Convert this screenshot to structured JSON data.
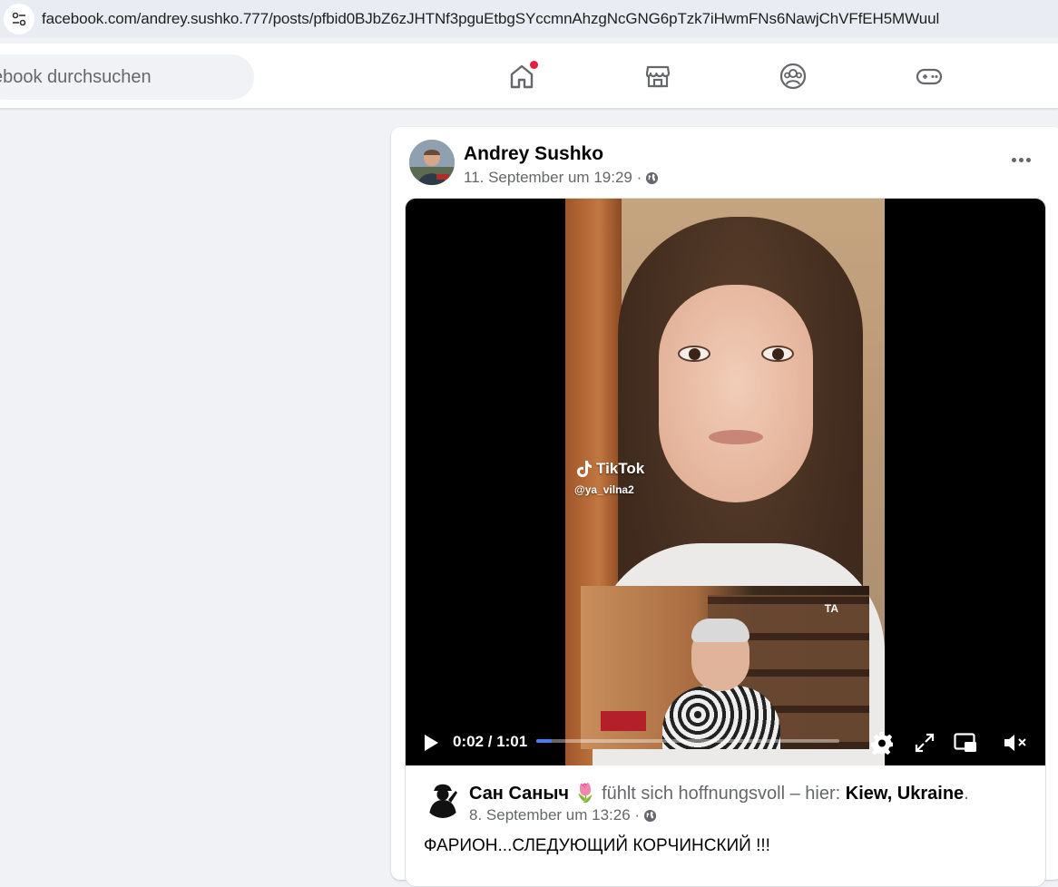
{
  "browser": {
    "url": "facebook.com/andrey.sushko.777/posts/pfbid0BJbZ6zJHTNf3pguEtbgSYccmnAhzgNcGNG6pTzk7iHwmFNs6NawjChVFfEH5MWuul",
    "site_info_icon": "tune-icon"
  },
  "nav": {
    "search_placeholder": "ebook durchsuchen",
    "icons": [
      "home-icon",
      "marketplace-icon",
      "groups-icon",
      "gaming-icon"
    ],
    "home_notification": true,
    "notification_color": "#e41e3f"
  },
  "post": {
    "author": "Andrey Sushko",
    "timestamp": "11. September um 19:29 ·",
    "privacy_icon": "globe-icon",
    "more_icon": "more-icon",
    "video": {
      "overlay_brand": "TikTok",
      "overlay_handle": "@ya_vilna2",
      "inset_logo": "ТА",
      "time": "0:02 / 1:01",
      "progress": 0.05,
      "accent": "#4a7cf6"
    },
    "shared": {
      "author": "Сан Саныч",
      "emoji": "🌷",
      "feeling": "fühlt sich hoffnungsvoll – hier:",
      "location": "Kiew, Ukraine",
      "period": ".",
      "timestamp": "8. September um 13:26 ·",
      "text": "ФАРИОН...СЛЕДУЮЩИЙ КОРЧИНСКИЙ !!!"
    }
  }
}
